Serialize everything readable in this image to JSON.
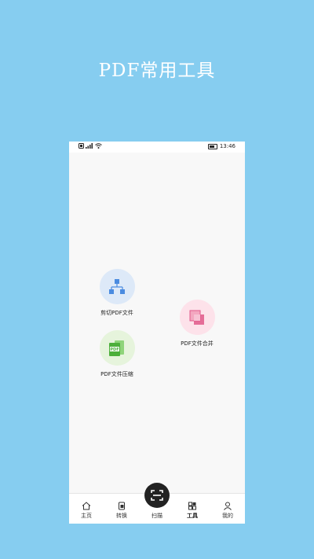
{
  "promo": {
    "title": "PDF常用工具"
  },
  "status_bar": {
    "left_icons": "sim-icon signal-icon wifi-icon",
    "time": "13:46"
  },
  "tools": [
    {
      "label": "剪切PDF文件",
      "icon": "split-tree-icon",
      "bg_color": "#dde9f8",
      "icon_color": "#4a8be0"
    },
    {
      "label": "PDF文件合并",
      "icon": "merge-squares-icon",
      "bg_color": "#fde2ea",
      "icon_color": "#e0588a"
    },
    {
      "label": "PDF文件压缩",
      "icon": "pdf-zip-icon",
      "bg_color": "#e6f4dc",
      "icon_color": "#4caf3a"
    }
  ],
  "tabbar": {
    "items": [
      {
        "label": "主页",
        "icon": "home-icon"
      },
      {
        "label": "转换",
        "icon": "convert-icon"
      },
      {
        "label": "扫描",
        "icon": "scan-icon"
      },
      {
        "label": "工具",
        "icon": "tools-grid-icon",
        "active": true
      },
      {
        "label": "我的",
        "icon": "person-icon"
      }
    ]
  }
}
